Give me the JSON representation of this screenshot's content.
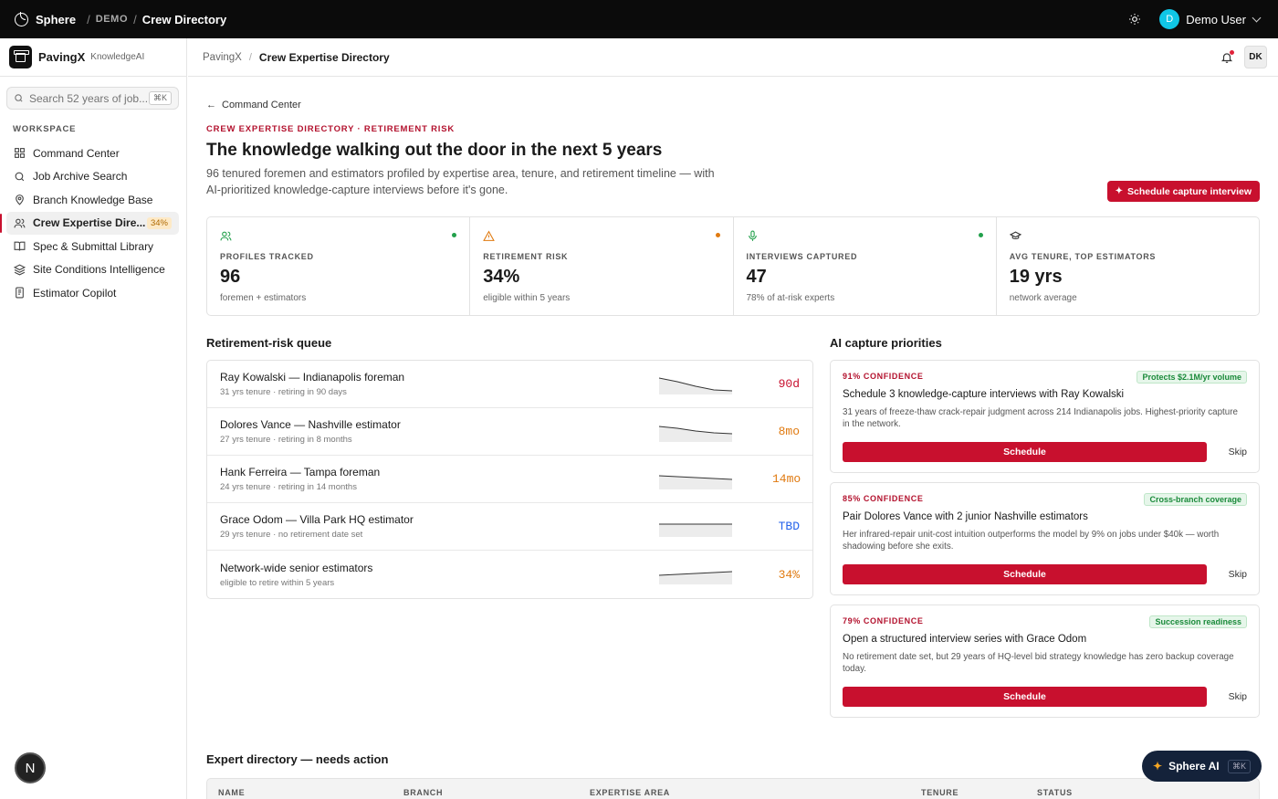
{
  "topbar": {
    "brand": "Sphere",
    "demo": "DEMO",
    "crumb": "Crew Directory",
    "user_initial": "D",
    "user_name": "Demo User"
  },
  "sidebar": {
    "brand": "PavingX",
    "sub": "KnowledgeAI",
    "search_placeholder": "Search 52 years of job...",
    "search_kbd": "⌘K",
    "section_label": "WORKSPACE",
    "items": [
      {
        "label": "Command Center",
        "icon": "grid-icon"
      },
      {
        "label": "Job Archive Search",
        "icon": "search-icon"
      },
      {
        "label": "Branch Knowledge Base",
        "icon": "map-pin-icon"
      },
      {
        "label": "Crew Expertise Dire...",
        "icon": "users-icon",
        "badge": "34%"
      },
      {
        "label": "Spec & Submittal Library",
        "icon": "book-icon"
      },
      {
        "label": "Site Conditions Intelligence",
        "icon": "layers-icon"
      },
      {
        "label": "Estimator Copilot",
        "icon": "doc-icon"
      }
    ]
  },
  "mainhead": {
    "crumb1": "PavingX",
    "sep": "/",
    "crumb2": "Crew Expertise Directory",
    "avatar": "DK"
  },
  "page": {
    "back": "Command Center",
    "eyebrow": "CREW EXPERTISE DIRECTORY · RETIREMENT RISK",
    "title": "The knowledge walking out the door in the next 5 years",
    "description": "96 tenured foremen and estimators profiled by expertise area, tenure, and retirement timeline — with AI-prioritized knowledge-capture interviews before it's gone.",
    "cta": "Schedule capture interview"
  },
  "stats": [
    {
      "label": "PROFILES TRACKED",
      "value": "96",
      "sub": "foremen + estimators",
      "icon": "users-icon",
      "dot": "#22a04b"
    },
    {
      "label": "RETIREMENT RISK",
      "value": "34%",
      "sub": "eligible within 5 years",
      "icon": "warning-icon",
      "dot": "#e07a10"
    },
    {
      "label": "INTERVIEWS CAPTURED",
      "value": "47",
      "sub": "78% of at-risk experts",
      "icon": "mic-icon",
      "dot": "#22a04b"
    },
    {
      "label": "AVG TENURE, TOP ESTIMATORS",
      "value": "19 yrs",
      "sub": "network average",
      "icon": "graduation-cap-icon"
    }
  ],
  "queue": {
    "title": "Retirement-risk queue",
    "rows": [
      {
        "title": "Ray Kowalski — Indianapolis foreman",
        "sub": "31 yrs tenure · retiring in 90 days",
        "value": "90d",
        "color": "#c8102e",
        "trend": [
          0.9,
          0.7,
          0.45,
          0.25,
          0.2
        ]
      },
      {
        "title": "Dolores Vance — Nashville estimator",
        "sub": "27 yrs tenure · retiring in 8 months",
        "value": "8mo",
        "color": "#e07a10",
        "trend": [
          0.85,
          0.75,
          0.6,
          0.5,
          0.45
        ]
      },
      {
        "title": "Hank Ferreira — Tampa foreman",
        "sub": "24 yrs tenure · retiring in 14 months",
        "value": "14mo",
        "color": "#e07a10",
        "trend": [
          0.75,
          0.7,
          0.65,
          0.6,
          0.55
        ]
      },
      {
        "title": "Grace Odom — Villa Park HQ estimator",
        "sub": "29 yrs tenure · no retirement date set",
        "value": "TBD",
        "color": "#2563eb",
        "trend": [
          0.7,
          0.7,
          0.7,
          0.7,
          0.7
        ]
      },
      {
        "title": "Network-wide senior estimators",
        "sub": "eligible to retire within 5 years",
        "value": "34%",
        "color": "#e07a10",
        "trend": [
          0.5,
          0.55,
          0.6,
          0.65,
          0.7
        ]
      }
    ]
  },
  "captures": {
    "title": "AI capture priorities",
    "items": [
      {
        "confidence": "91% CONFIDENCE",
        "tag": "Protects $2.1M/yr volume",
        "title": "Schedule 3 knowledge-capture interviews with Ray Kowalski",
        "desc": "31 years of freeze-thaw crack-repair judgment across 214 Indianapolis jobs. Highest-priority capture in the network.",
        "action": "Schedule",
        "skip": "Skip"
      },
      {
        "confidence": "85% CONFIDENCE",
        "tag": "Cross-branch coverage",
        "title": "Pair Dolores Vance with 2 junior Nashville estimators",
        "desc": "Her infrared-repair unit-cost intuition outperforms the model by 9% on jobs under $40k — worth shadowing before she exits.",
        "action": "Schedule",
        "skip": "Skip"
      },
      {
        "confidence": "79% CONFIDENCE",
        "tag": "Succession readiness",
        "title": "Open a structured interview series with Grace Odom",
        "desc": "No retirement date set, but 29 years of HQ-level bid strategy knowledge has zero backup coverage today.",
        "action": "Schedule",
        "skip": "Skip"
      }
    ]
  },
  "directory": {
    "title": "Expert directory — needs action",
    "columns": [
      "NAME",
      "BRANCH",
      "EXPERTISE AREA",
      "TENURE",
      "STATUS"
    ]
  },
  "sphere_ai": {
    "label": "Sphere AI",
    "kbd": "⌘K"
  },
  "colors": {
    "accent": "#c8102e",
    "dark": "#0b0b0b"
  }
}
